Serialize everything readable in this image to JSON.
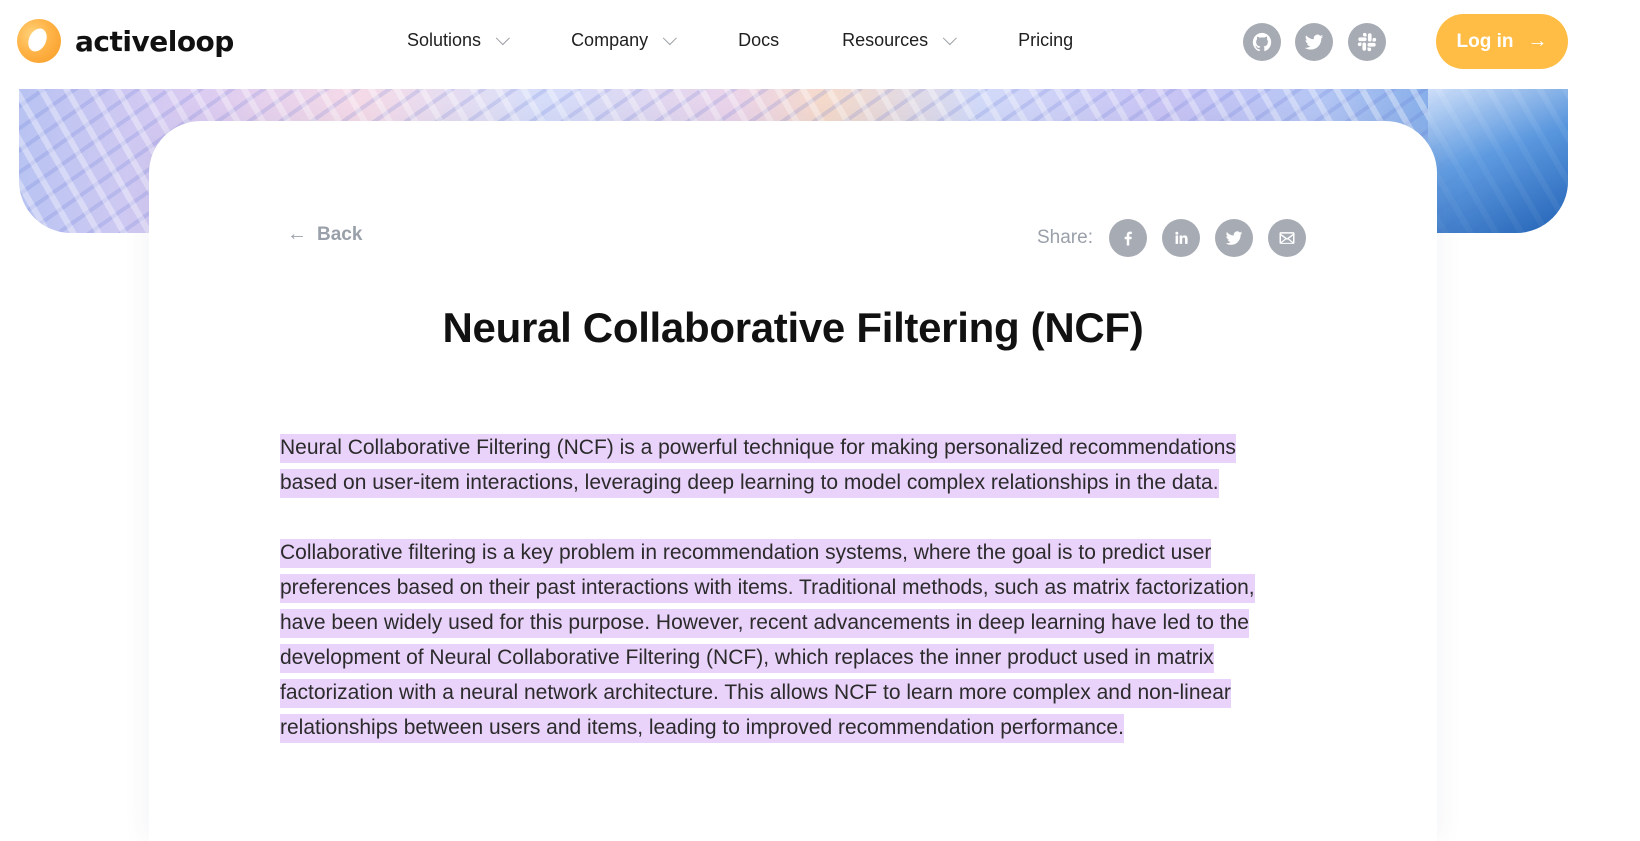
{
  "header": {
    "logo_text": "activeloop",
    "nav": {
      "solutions": "Solutions",
      "company": "Company",
      "docs": "Docs",
      "resources": "Resources",
      "pricing": "Pricing"
    },
    "social_icons": [
      "github-icon",
      "twitter-icon",
      "slack-icon"
    ],
    "login_label": "Log in",
    "login_arrow": "→"
  },
  "article": {
    "back_label": "Back",
    "back_arrow": "←",
    "share_label": "Share:",
    "share_icons": [
      "facebook-icon",
      "linkedin-icon",
      "twitter-icon",
      "email-icon"
    ],
    "title": "Neural Collaborative Filtering (NCF)",
    "paragraphs": [
      "Neural Collaborative Filtering (NCF) is a powerful technique for making personalized recommendations based on user-item interactions, leveraging deep learning to model complex relationships in the data.",
      "Collaborative filtering is a key problem in recommendation systems, where the goal is to predict user preferences based on their past interactions with items. Traditional methods, such as matrix factorization, have been widely used for this purpose. However, recent advancements in deep learning have led to the development of Neural Collaborative Filtering (NCF), which replaces the inner product used in matrix factorization with a neural network architecture. This allows NCF to learn more complex and non-linear relationships between users and items, leading to improved recommendation performance."
    ]
  },
  "colors": {
    "accent": "#ffbd45",
    "icon_grey": "#a7abb4",
    "highlight": "#ead3fb"
  }
}
